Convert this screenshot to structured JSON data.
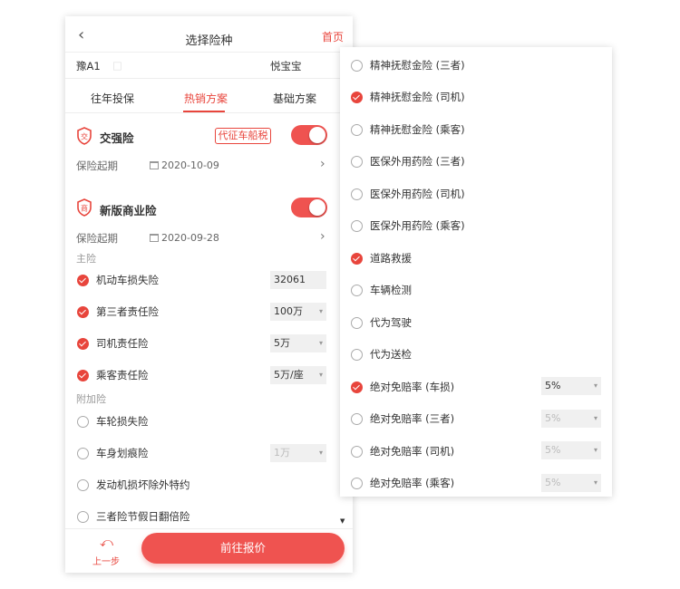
{
  "colors": {
    "accent": "#e8453c",
    "toggle_on": "#ef5350",
    "select_bg": "#f0f0f0"
  },
  "left": {
    "header": {
      "back_icon": "chevron-left-icon",
      "back_glyph": "‹",
      "title": "选择险种",
      "home_label": "首页"
    },
    "plate": "豫A1",
    "plate_mask": "□",
    "owner": "悦宝宝",
    "tabs": [
      {
        "label": "往年投保",
        "active": false
      },
      {
        "label": "热销方案",
        "active": true
      },
      {
        "label": "基础方案",
        "active": false
      }
    ],
    "compulsory": {
      "icon_char": "交",
      "title": "交强险",
      "tax_button": "代征车船税",
      "enabled": true,
      "start_label": "保险起期",
      "start_date": "2020-10-09",
      "chevron": "›"
    },
    "commercial": {
      "icon_char": "商",
      "title": "新版商业险",
      "enabled": true,
      "start_label": "保险起期",
      "start_date": "2020-09-28",
      "chevron": "›"
    },
    "main_section_label": "主险",
    "main_items": [
      {
        "label": "机动车损失险",
        "checked": true,
        "value": "32061",
        "has_arrow": false
      },
      {
        "label": "第三者责任险",
        "checked": true,
        "value": "100万",
        "has_arrow": true
      },
      {
        "label": "司机责任险",
        "checked": true,
        "value": "5万",
        "has_arrow": true
      },
      {
        "label": "乘客责任险",
        "checked": true,
        "value": "5万/座",
        "has_arrow": true
      }
    ],
    "addon_section_label": "附加险",
    "addon_items": [
      {
        "label": "车轮损失险",
        "checked": false
      },
      {
        "label": "车身划痕险",
        "checked": false,
        "value": "1万",
        "has_arrow": true
      },
      {
        "label": "发动机损坏除外特约",
        "checked": false
      },
      {
        "label": "三者险节假日翻倍险",
        "checked": false
      }
    ],
    "arrow_glyph": "▾",
    "scroll_glyph": "▼",
    "footer": {
      "prev_icon": "undo-arrow-icon",
      "prev_glyph": "⤺",
      "prev_label": "上一步",
      "cta_label": "前往报价"
    }
  },
  "right": {
    "items": [
      {
        "label": "精神抚慰金险 (三者)",
        "checked": false
      },
      {
        "label": "精神抚慰金险 (司机)",
        "checked": true
      },
      {
        "label": "精神抚慰金险 (乘客)",
        "checked": false
      },
      {
        "label": "医保外用药险 (三者)",
        "checked": false
      },
      {
        "label": "医保外用药险 (司机)",
        "checked": false
      },
      {
        "label": "医保外用药险 (乘客)",
        "checked": false
      },
      {
        "label": "道路救援",
        "checked": true
      },
      {
        "label": "车辆检测",
        "checked": false
      },
      {
        "label": "代为驾驶",
        "checked": false
      },
      {
        "label": "代为送检",
        "checked": false
      },
      {
        "label": "绝对免赔率 (车损)",
        "checked": true,
        "value": "5%",
        "disabled": false
      },
      {
        "label": "绝对免赔率 (三者)",
        "checked": false,
        "value": "5%",
        "disabled": true
      },
      {
        "label": "绝对免赔率 (司机)",
        "checked": false,
        "value": "5%",
        "disabled": true
      },
      {
        "label": "绝对免赔率 (乘客)",
        "checked": false,
        "value": "5%",
        "disabled": true
      }
    ]
  }
}
